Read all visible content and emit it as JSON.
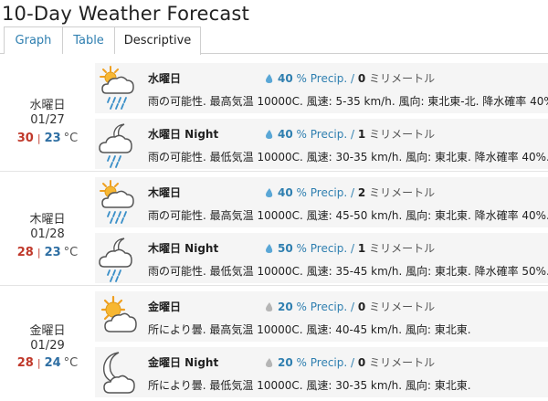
{
  "page_title": "10-Day Weather Forecast",
  "tabs": [
    {
      "label": "Graph",
      "active": false
    },
    {
      "label": "Table",
      "active": false
    },
    {
      "label": "Descriptive",
      "active": true
    }
  ],
  "temp_unit": "°C",
  "precip_suffix": "% Precip. /",
  "mm_unit": "ミリメートル",
  "colors": {
    "high_temp": "#c0392b",
    "low_temp": "#2f6fa3",
    "link": "#2f7fb0",
    "rain_drop": "#5aa7d6",
    "dry_drop": "#b5b5b5"
  },
  "days": [
    {
      "name": "水曜日",
      "date": "01/27",
      "high": "30",
      "low": "23",
      "day": {
        "name": "水曜日",
        "icon": "partly-cloudy-rain-icon",
        "precip": "40",
        "mm": "0",
        "desc": "雨の可能性. 最高気温 10000C. 風速: 5-35 km/h. 風向: 東北東-北. 降水確率 40%."
      },
      "night": {
        "name": "水曜日 Night",
        "icon": "night-cloudy-rain-icon",
        "precip": "40",
        "mm": "1",
        "desc": "雨の可能性. 最低気温 10000C. 風速: 30-35 km/h. 風向: 東北東. 降水確率 40%."
      }
    },
    {
      "name": "木曜日",
      "date": "01/28",
      "high": "28",
      "low": "23",
      "day": {
        "name": "木曜日",
        "icon": "partly-cloudy-rain-icon",
        "precip": "40",
        "mm": "2",
        "desc": "雨の可能性. 最高気温 10000C. 風速: 45-50 km/h. 風向: 東北東. 降水確率 40%."
      },
      "night": {
        "name": "木曜日 Night",
        "icon": "night-cloudy-rain-icon",
        "precip": "50",
        "mm": "1",
        "desc": "雨の可能性. 最低気温 10000C. 風速: 35-45 km/h. 風向: 東北東. 降水確率 50%."
      }
    },
    {
      "name": "金曜日",
      "date": "01/29",
      "high": "28",
      "low": "24",
      "day": {
        "name": "金曜日",
        "icon": "sun-cloud-icon",
        "precip": "20",
        "mm": "0",
        "desc": "所により曇. 最高気温 10000C. 風速: 40-45 km/h. 風向: 東北東."
      },
      "night": {
        "name": "金曜日 Night",
        "icon": "moon-cloud-icon",
        "precip": "20",
        "mm": "0",
        "desc": "所により曇. 最低気温 10000C. 風速: 30-35 km/h. 風向: 東北東."
      }
    }
  ]
}
